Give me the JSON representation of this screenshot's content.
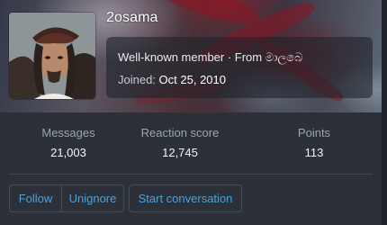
{
  "profile": {
    "username": "2osama",
    "title_line": "Well-known member · From මාලබෙ",
    "joined_label": "Joined:",
    "joined_date": "Oct 25, 2010"
  },
  "stats": [
    {
      "label": "Messages",
      "value": "21,003"
    },
    {
      "label": "Reaction score",
      "value": "12,745"
    },
    {
      "label": "Points",
      "value": "113"
    }
  ],
  "actions": {
    "follow": "Follow",
    "unignore": "Unignore",
    "start_conversation": "Start conversation"
  },
  "colors": {
    "accent_link": "#4ea0d8",
    "card_bg": "#2c3038",
    "muted_text": "#9aa4b0"
  }
}
